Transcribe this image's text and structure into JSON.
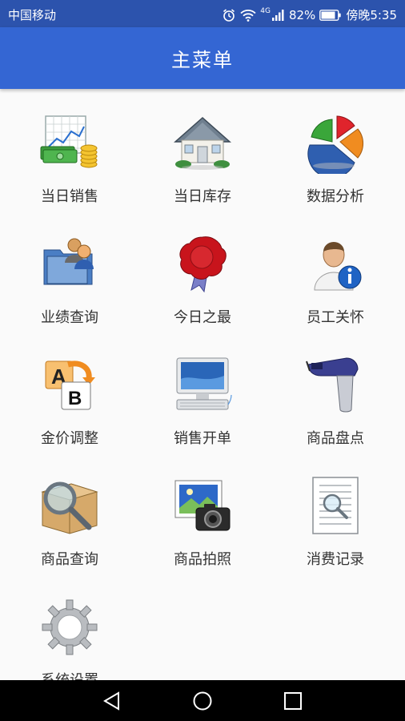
{
  "status": {
    "carrier": "中国移动",
    "network": "4G",
    "battery": "82%",
    "time": "傍晚5:35",
    "battery_level": 0.82
  },
  "appbar": {
    "title": "主菜单"
  },
  "menu": [
    {
      "label": "当日销售",
      "icon": "sales-chart-money-icon"
    },
    {
      "label": "当日库存",
      "icon": "house-icon"
    },
    {
      "label": "数据分析",
      "icon": "pie-chart-icon"
    },
    {
      "label": "业绩查询",
      "icon": "folder-users-icon"
    },
    {
      "label": "今日之最",
      "icon": "wax-seal-ribbon-icon"
    },
    {
      "label": "员工关怀",
      "icon": "user-info-icon"
    },
    {
      "label": "金价调整",
      "icon": "a-to-b-swap-icon"
    },
    {
      "label": "销售开单",
      "icon": "computer-monitor-icon"
    },
    {
      "label": "商品盘点",
      "icon": "barcode-scanner-icon"
    },
    {
      "label": "商品查询",
      "icon": "box-magnifier-icon"
    },
    {
      "label": "商品拍照",
      "icon": "photo-camera-icon"
    },
    {
      "label": "消费记录",
      "icon": "document-search-icon"
    },
    {
      "label": "系统设置",
      "icon": "gear-icon"
    }
  ],
  "navbar": {
    "back_icon": "back-triangle-icon",
    "home_icon": "home-circle-icon",
    "recents_icon": "recents-square-icon"
  }
}
